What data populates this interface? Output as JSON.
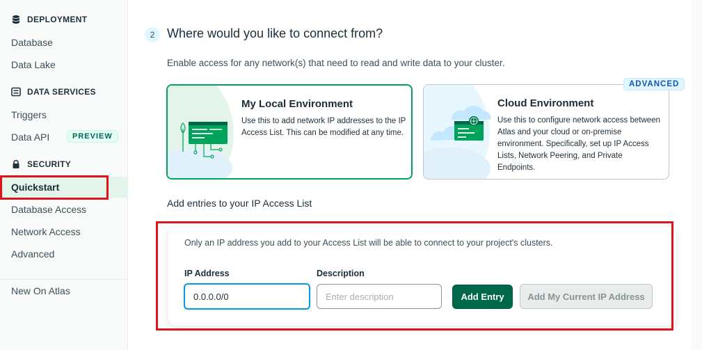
{
  "sidebar": {
    "deployment": {
      "heading": "DEPLOYMENT",
      "icon": "database-icon",
      "items": [
        "Database",
        "Data Lake"
      ]
    },
    "data_services": {
      "heading": "DATA SERVICES",
      "icon": "list-icon",
      "items": [
        "Triggers",
        "Data API"
      ],
      "data_api_badge": "PREVIEW"
    },
    "security": {
      "heading": "SECURITY",
      "icon": "lock-icon",
      "items": [
        "Quickstart",
        "Database Access",
        "Network Access",
        "Advanced"
      ],
      "active": "Quickstart"
    },
    "footer_item": "New On Atlas"
  },
  "step": {
    "number": "2",
    "title": "Where would you like to connect from?",
    "description": "Enable access for any network(s) that need to read and write data to your cluster."
  },
  "environments": {
    "local": {
      "title": "My Local Environment",
      "description": "Use this to add network IP addresses to the IP Access List. This can be modified at any time.",
      "selected": true
    },
    "cloud": {
      "title": "Cloud Environment",
      "description": "Use this to configure network access between Atlas and your cloud or on-premise environment. Specifically, set up IP Access Lists, Network Peering, and Private Endpoints.",
      "badge": "ADVANCED",
      "selected": false
    }
  },
  "ip_access": {
    "heading": "Add entries to your IP Access List",
    "info": "Only an IP address you add to your Access List will be able to connect to your project's clusters.",
    "ip_label": "IP Address",
    "ip_value": "0.0.0.0/0",
    "description_label": "Description",
    "description_placeholder": "Enter description",
    "add_button": "Add Entry",
    "current_ip_button": "Add My Current IP Address"
  },
  "colors": {
    "accent_green": "#00684a",
    "selected_border": "#00a35c",
    "highlight_red": "#e0131c",
    "focus_blue": "#0498ec"
  }
}
